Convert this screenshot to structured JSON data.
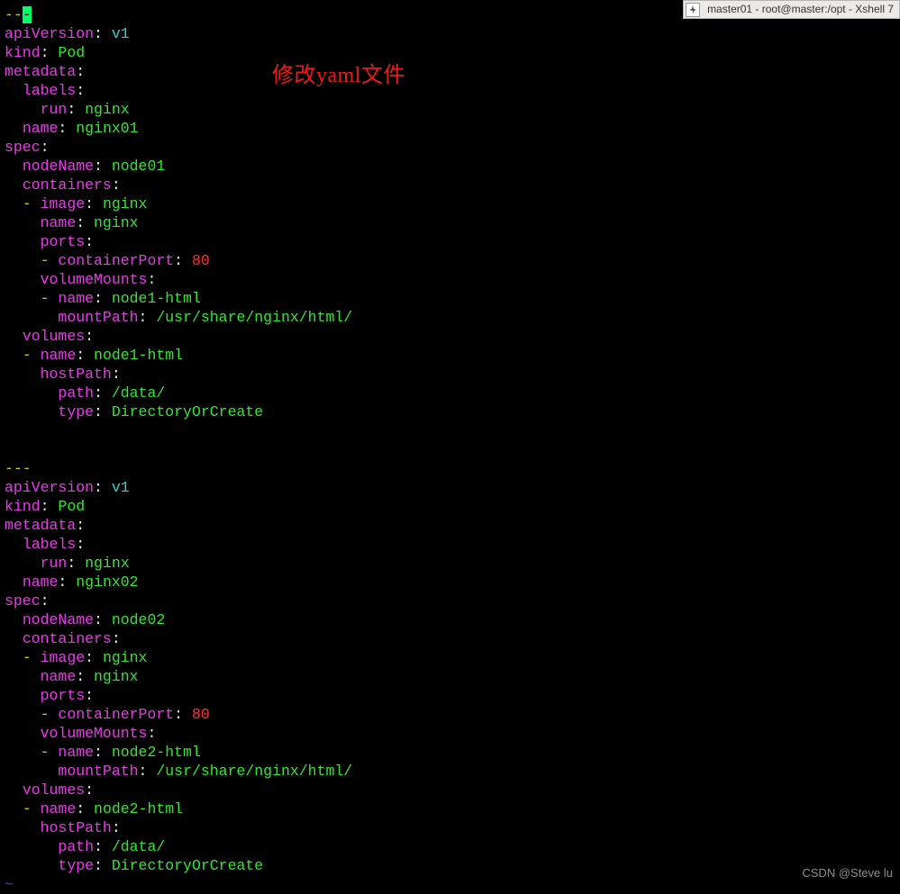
{
  "titlebar": {
    "text": "master01 - root@master:/opt - Xshell 7"
  },
  "annotation": "修改yaml文件",
  "watermark": "CSDN @Steve lu",
  "yaml": {
    "docmark_pre": "--",
    "docmark_char": "-",
    "apiVersionKey": "apiVersion",
    "apiVersionVal": "v1",
    "kindKey": "kind",
    "kindVal": "Pod",
    "metadataKey": "metadata",
    "labelsKey": "labels",
    "runKey": "run",
    "runVal": "nginx",
    "nameKey": "name",
    "specKey": "spec",
    "nodeNameKey": "nodeName",
    "containersKey": "containers",
    "imageKey": "image",
    "imageVal": "nginx",
    "cNameVal": "nginx",
    "portsKey": "ports",
    "containerPortKey": "containerPort",
    "containerPortVal": "80",
    "volumeMountsKey": "volumeMounts",
    "mountPathKey": "mountPath",
    "mountPathVal": "/usr/share/nginx/html/",
    "volumesKey": "volumes",
    "hostPathKey": "hostPath",
    "pathKey": "path",
    "pathVal": "/data/",
    "typeKey": "type",
    "typeVal": "DirectoryOrCreate",
    "doc1": {
      "name": "nginx01",
      "node": "node01",
      "vol": "node1-html"
    },
    "doc2": {
      "name": "nginx02",
      "node": "node02",
      "vol": "node2-html"
    },
    "sep": "---",
    "tilde": "~"
  }
}
